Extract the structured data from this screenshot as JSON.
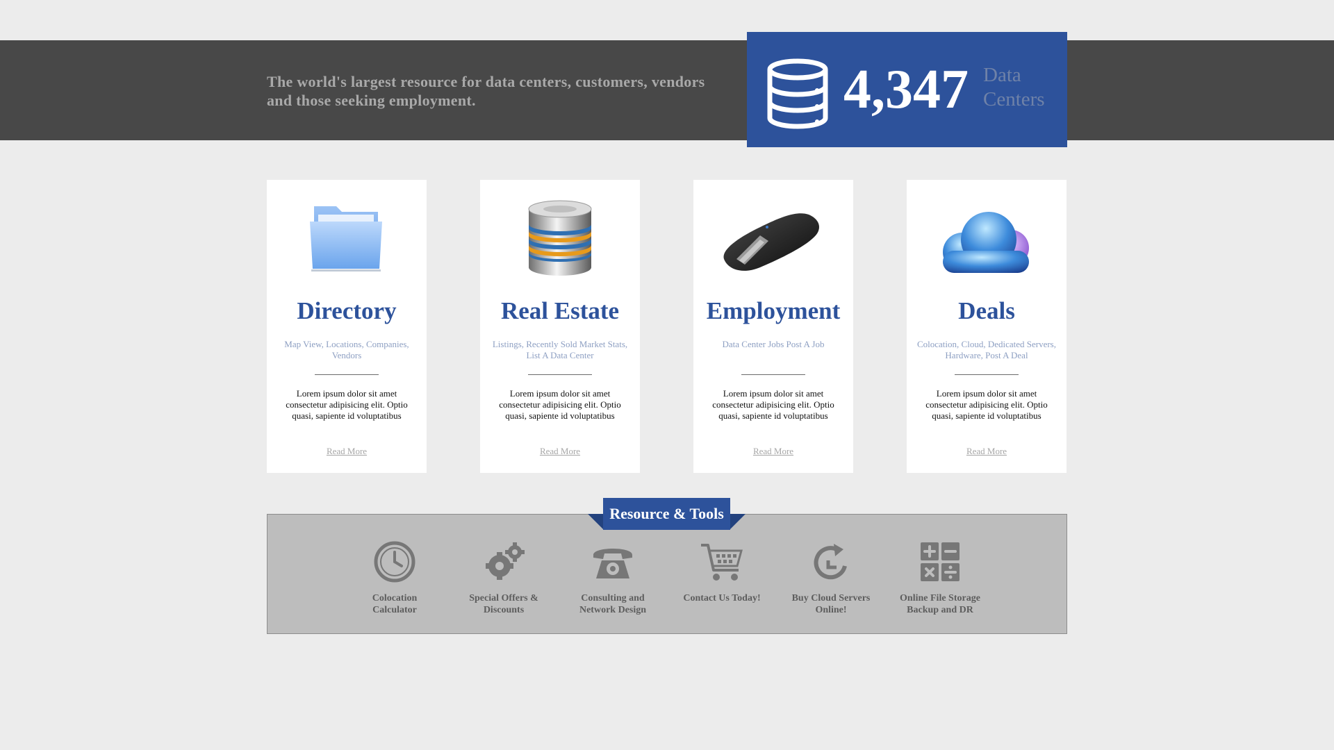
{
  "header": {
    "tagline": "The world's largest resource for data centers, customers, vendors and those seeking employment.",
    "counter_value": "4,347",
    "counter_unit": "Data Centers",
    "counter_icon": "database-icon",
    "colors": {
      "banner": "#484848",
      "accent": "#2d529b"
    }
  },
  "cards": [
    {
      "icon": "folder-icon",
      "title": "Directory",
      "subtitle": "Map View, Locations, Companies, Vendors",
      "body": "Lorem ipsum dolor sit amet consectetur adipisicing elit. Optio quasi, sapiente id voluptatibus",
      "link": "Read More"
    },
    {
      "icon": "database-stack-icon",
      "title": "Real Estate",
      "subtitle": "Listings, Recently Sold Market Stats, List A Data Center",
      "body": "Lorem ipsum dolor sit amet consectetur adipisicing elit. Optio quasi, sapiente id voluptatibus",
      "link": "Read More"
    },
    {
      "icon": "mouse-icon",
      "title": "Employment",
      "subtitle": "Data Center Jobs Post A Job",
      "body": "Lorem ipsum dolor sit amet consectetur adipisicing elit. Optio quasi, sapiente id voluptatibus",
      "link": "Read More"
    },
    {
      "icon": "cloud-icon",
      "title": "Deals",
      "subtitle": "Colocation, Cloud, Dedicated Servers, Hardware, Post A Deal",
      "body": "Lorem ipsum dolor sit amet consectetur adipisicing elit. Optio quasi, sapiente id voluptatibus",
      "link": "Read More"
    }
  ],
  "tools": {
    "heading": "Resource & Tools",
    "items": [
      {
        "icon": "clock-icon",
        "label": "Colocation Calculator"
      },
      {
        "icon": "gears-icon",
        "label": "Special Offers & Discounts"
      },
      {
        "icon": "telephone-icon",
        "label": "Consulting and Network Design"
      },
      {
        "icon": "shopping-cart-icon",
        "label": "Contact Us Today!"
      },
      {
        "icon": "refresh-icon",
        "label": "Buy Cloud Servers Online!"
      },
      {
        "icon": "calculator-icon",
        "label": "Online File Storage Backup and DR"
      }
    ]
  }
}
